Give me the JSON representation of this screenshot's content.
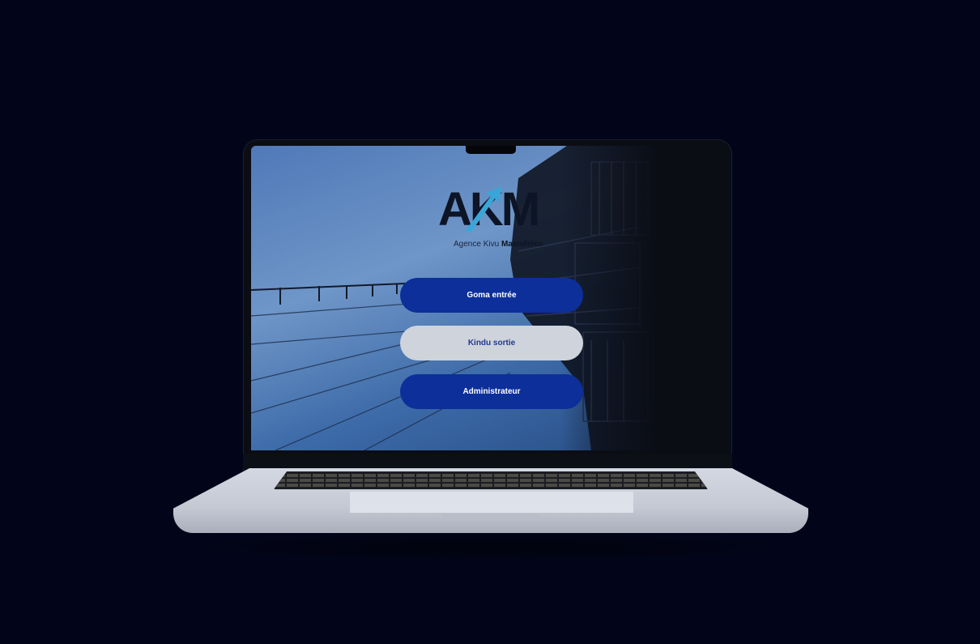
{
  "app": {
    "logo_text": "AKM",
    "logo_subtitle_light": "Agence Kivu ",
    "logo_subtitle_bold": "Maendeleo"
  },
  "buttons": [
    {
      "label": "Goma entrée"
    },
    {
      "label": "Kindu sortie"
    },
    {
      "label": "Administrateur"
    }
  ],
  "colors": {
    "primary_button": "#0d2f9a",
    "secondary_button": "#cfd3db",
    "logo_arrow": "#3aa6d8",
    "background": "#02051a"
  }
}
